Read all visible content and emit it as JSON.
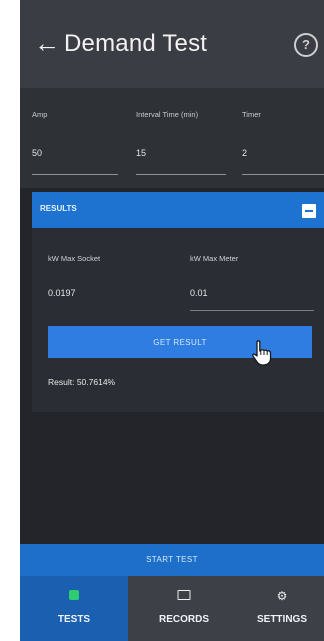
{
  "header": {
    "title": "Demand Test",
    "back_icon": "arrow-left-icon",
    "help_icon": "help-circle-icon"
  },
  "params": [
    {
      "label": "Amp",
      "value": "50"
    },
    {
      "label": "Interval Time (min)",
      "value": "15"
    },
    {
      "label": "Timer",
      "value": "2"
    }
  ],
  "results": {
    "title": "RESULTS",
    "kw_max_socket_label": "kW Max Socket",
    "kw_max_socket_value": "0.0197",
    "kw_max_meter_label": "kW Max Meter",
    "kw_max_meter_value": "0.01",
    "get_result_label": "GET RESULT",
    "result_text": "Result: 50.7614%"
  },
  "start_test_label": "START TEST",
  "nav": {
    "tests": "TESTS",
    "records": "RECORDS",
    "settings": "SETTINGS"
  },
  "colors": {
    "accent": "#1f73d0",
    "active_tab": "#1b5fb1",
    "tests_icon": "#2ecc71"
  }
}
